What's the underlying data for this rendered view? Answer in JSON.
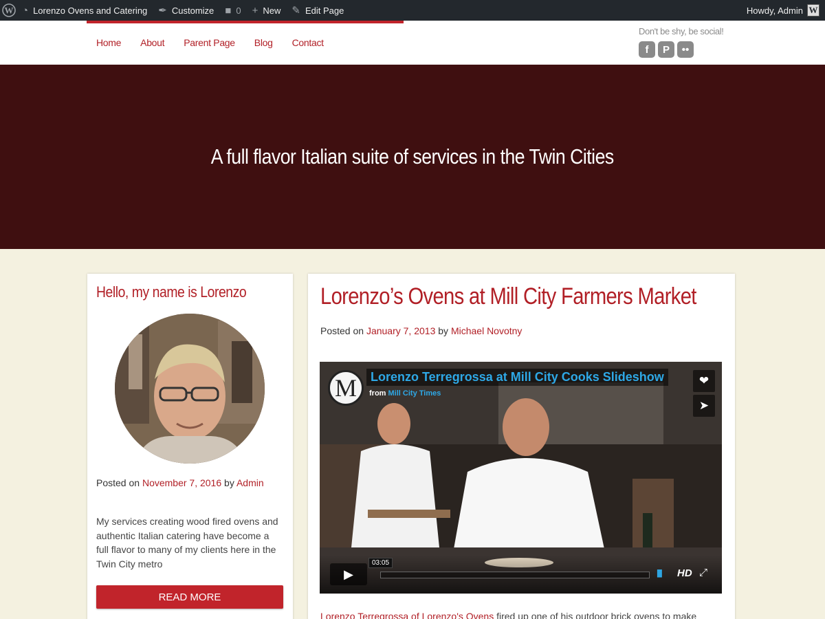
{
  "admin_bar": {
    "site_name": "Lorenzo Ovens and Catering",
    "customize": "Customize",
    "comments_count": "0",
    "new": "New",
    "edit_page": "Edit Page",
    "greeting": "Howdy, Admin"
  },
  "nav": {
    "items": [
      "Home",
      "About",
      "Parent Page",
      "Blog",
      "Contact"
    ]
  },
  "social": {
    "label": "Don't be shy, be social!",
    "icons": [
      "facebook-icon",
      "pinterest-icon",
      "flickr-icon"
    ]
  },
  "hero": {
    "tagline": "A full flavor Italian suite of services in the Twin Cities"
  },
  "sidebar": {
    "title": "Hello, my name is Lorenzo",
    "posted_prefix": "Posted on",
    "posted_date": "November 7, 2016",
    "posted_by": "by",
    "author": "Admin",
    "excerpt": "My services creating wood fired ovens and authentic Italian catering have become a full flavor to many of my clients here in the Twin City metro",
    "read_more": "READ MORE"
  },
  "post": {
    "title": "Lorenzo’s Ovens at Mill City Farmers Market",
    "posted_prefix": "Posted on",
    "posted_date": "January 7, 2013",
    "posted_by": "by",
    "author": "Michael Novotny",
    "video": {
      "logo_letter": "M",
      "title": "Lorenzo Terregrossa at Mill City Cooks Slideshow",
      "from_prefix": "from",
      "from_channel": "Mill City Times",
      "time": "03:05",
      "hd_label": "HD"
    },
    "body_link": "Lorenzo Terregrossa of Lorenzo's Ovens",
    "body_text": " fired up one of his outdoor brick ovens to make"
  },
  "colors": {
    "accent": "#c1242b",
    "link": "#b11f26",
    "hero_bg": "#3f0f10",
    "page_bg": "#f4f1e0",
    "admin_bg": "#23282d",
    "video_title": "#2ea8e6"
  }
}
